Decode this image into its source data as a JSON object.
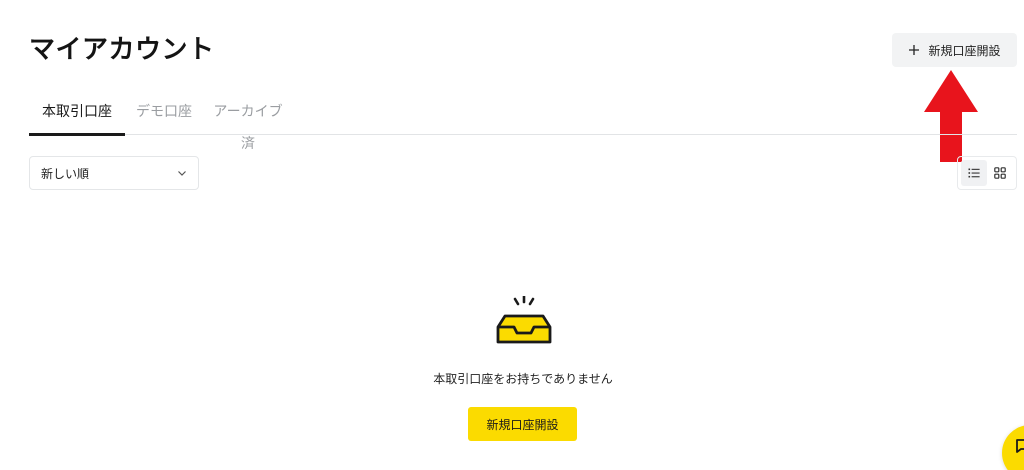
{
  "page": {
    "title": "マイアカウント"
  },
  "header": {
    "new_account_label": "新規口座開設",
    "new_account_icon": "plus-icon"
  },
  "tabs": [
    {
      "label": "本取引口座",
      "active": true
    },
    {
      "label": "デモ口座",
      "active": false
    },
    {
      "label": "アーカイブ済",
      "active": false
    }
  ],
  "sort": {
    "selected": "新しい順",
    "icon": "chevron-down-icon"
  },
  "view_toggle": [
    {
      "icon": "list-icon",
      "active": true
    },
    {
      "icon": "grid-icon",
      "active": false
    }
  ],
  "empty_state": {
    "icon": "empty-tray-icon",
    "message": "本取引口座をお持ちでありません",
    "cta_label": "新規口座開設"
  },
  "chat": {
    "icon": "chat-icon"
  },
  "colors": {
    "accent": "#fbdb00",
    "annotation_arrow": "#e8141c",
    "active_tab": "#1a1a1a",
    "inactive_tab": "#9a9da1",
    "button_bg": "#f2f3f4"
  }
}
